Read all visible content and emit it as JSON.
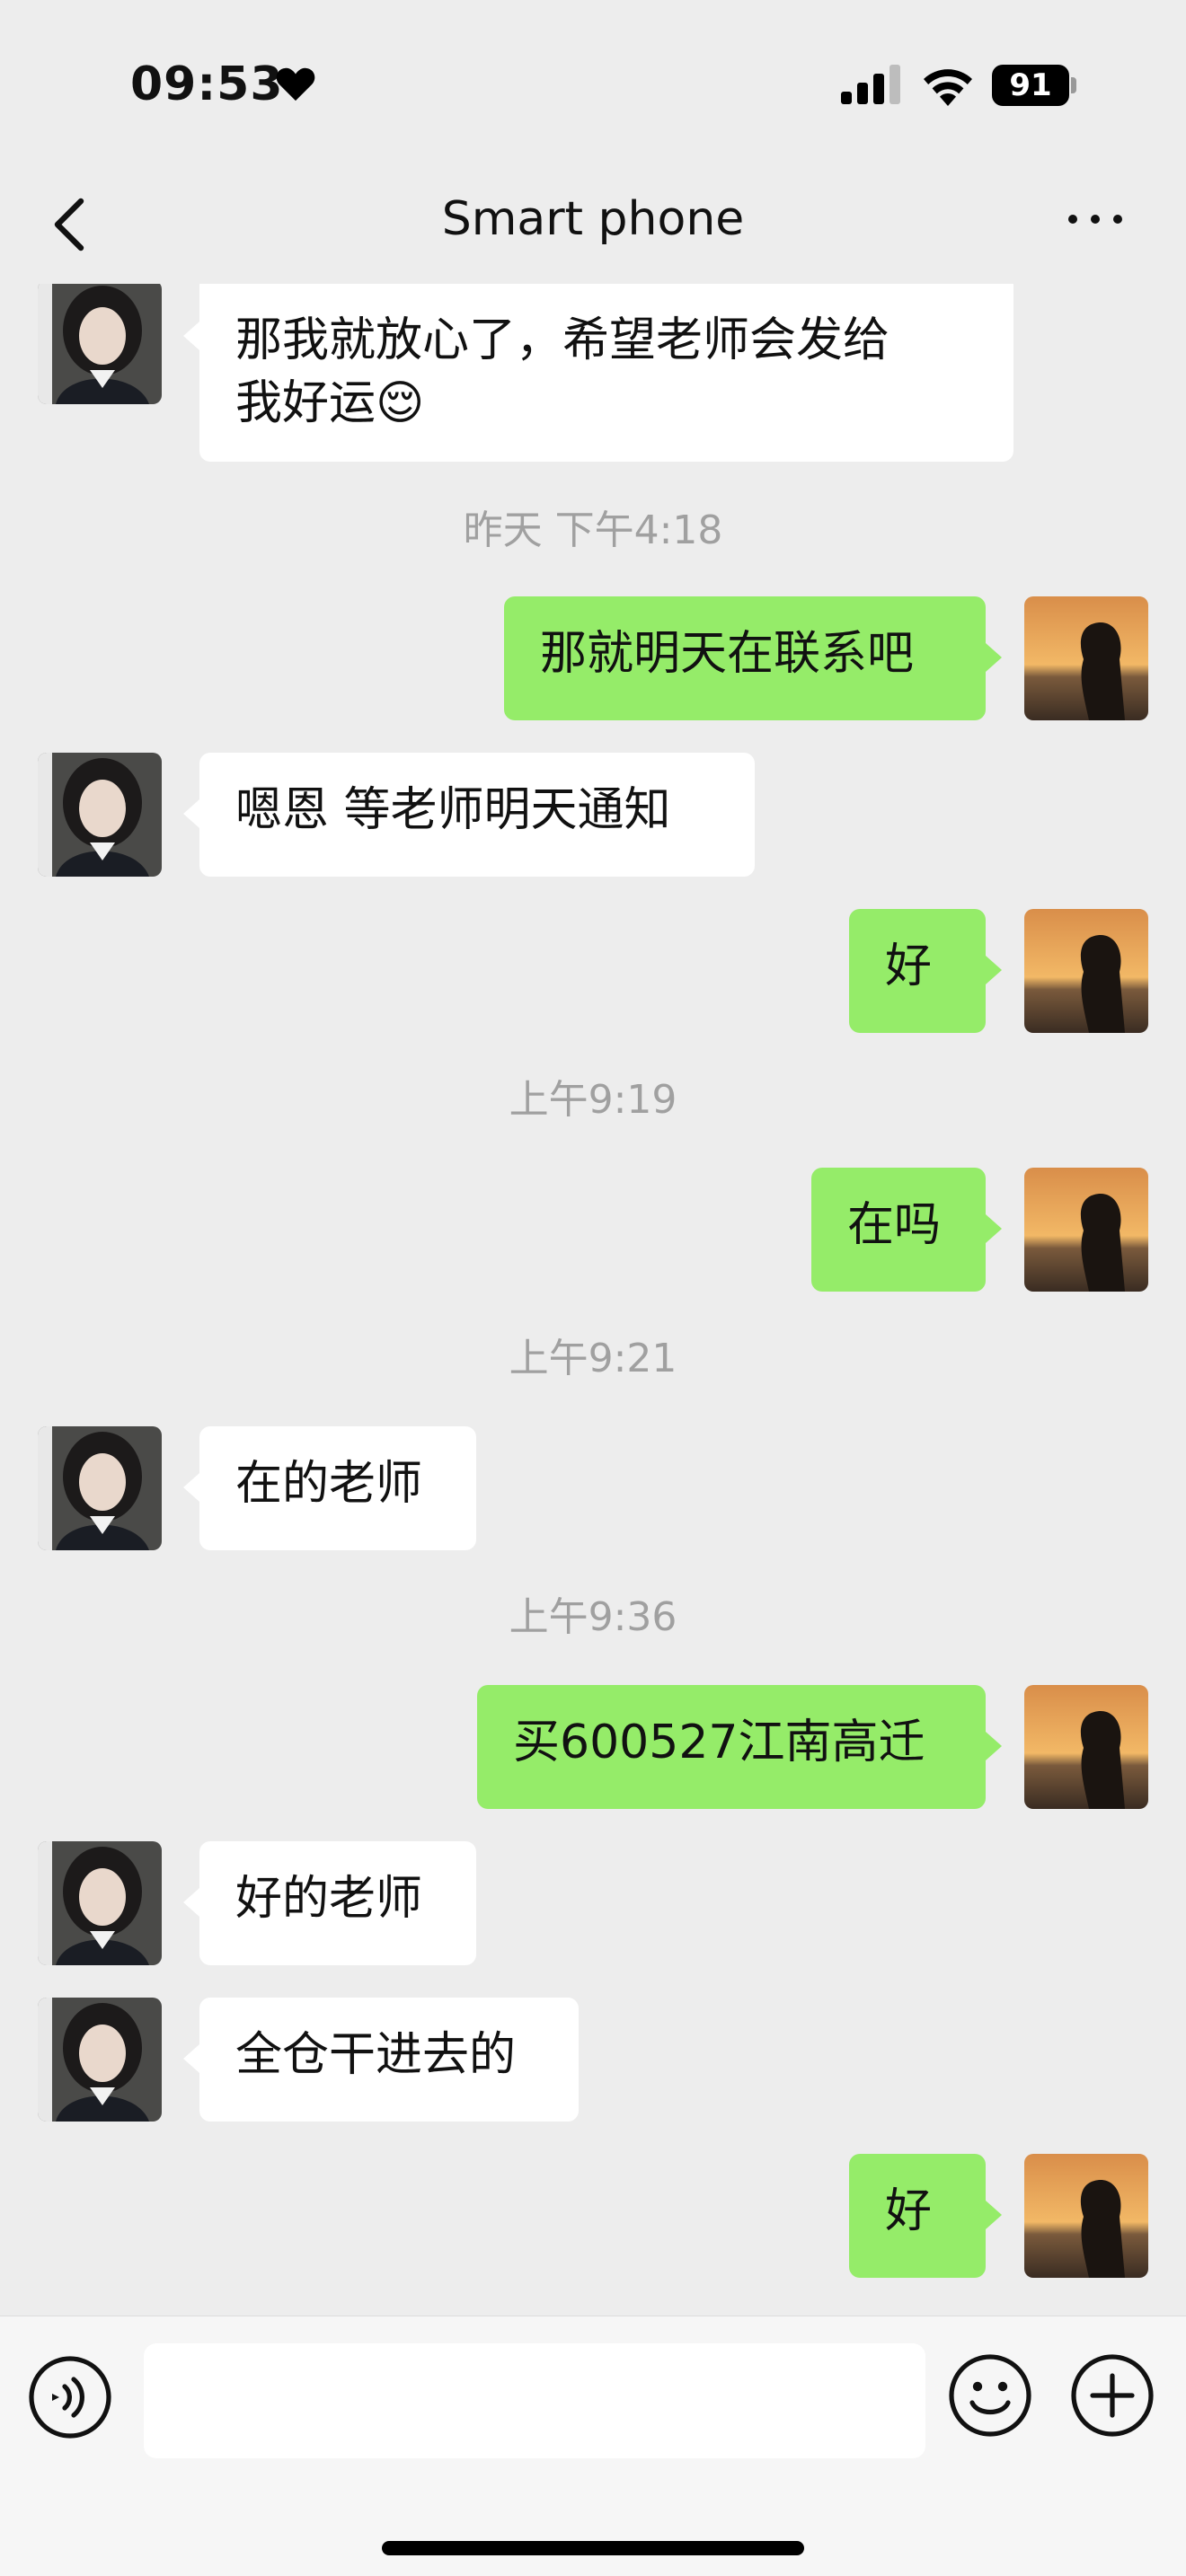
{
  "status_bar": {
    "time": "09:53",
    "battery": "91"
  },
  "nav": {
    "title": "Smart phone"
  },
  "timestamps": {
    "t1": "昨天 下午4:18",
    "t2": "上午9:19",
    "t3": "上午9:21",
    "t4": "上午9:36"
  },
  "messages": [
    {
      "side": "left",
      "line1": "那我就放心了，希望老师会发给",
      "line2": "我好运😌"
    },
    {
      "side": "right",
      "text": "那就明天在联系吧"
    },
    {
      "side": "left",
      "text": "嗯恩  等老师明天通知"
    },
    {
      "side": "right",
      "text": "好"
    },
    {
      "side": "right",
      "text": "在吗"
    },
    {
      "side": "left",
      "text": "在的老师"
    },
    {
      "side": "right",
      "text": "买600527江南高迁"
    },
    {
      "side": "left",
      "text": "好的老师"
    },
    {
      "side": "left",
      "text": "全仓干进去的"
    },
    {
      "side": "right",
      "text": "好"
    }
  ],
  "input": {
    "placeholder": ""
  },
  "colors": {
    "own_bubble": "#95ec69",
    "other_bubble": "#ffffff",
    "background": "#ededed"
  },
  "icons": [
    "heart-icon",
    "signal-icon",
    "wifi-icon",
    "battery-icon",
    "back-icon",
    "more-icon",
    "voice-icon",
    "emoji-icon",
    "plus-icon"
  ]
}
